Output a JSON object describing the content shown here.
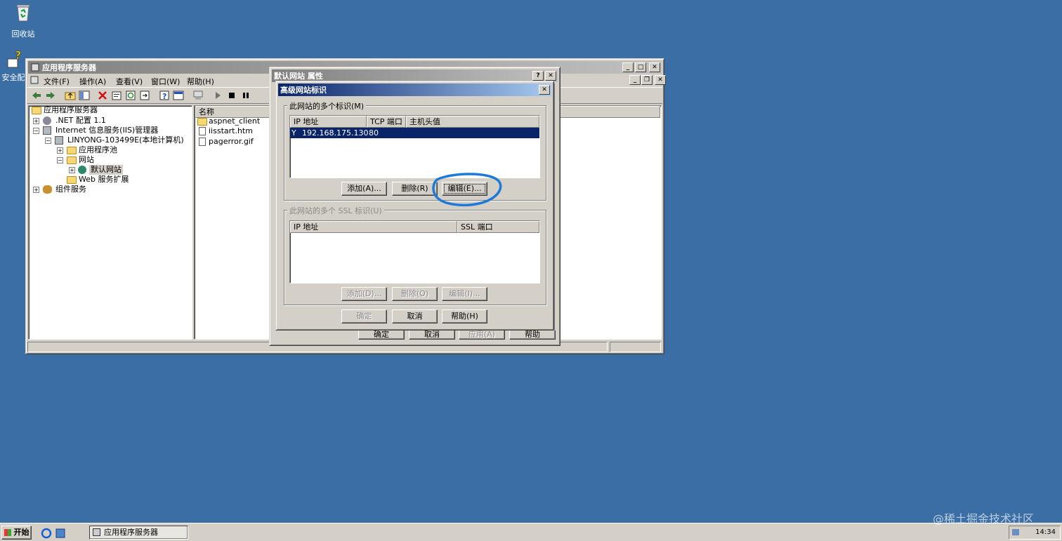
{
  "desktop": {
    "icons": [
      {
        "label": "回收站",
        "icon": "recycle-bin-icon"
      },
      {
        "label": "安全配",
        "icon": "security-config-icon"
      }
    ]
  },
  "main_window": {
    "title": "应用程序服务器",
    "menu": [
      "文件(F)",
      "操作(A)",
      "查看(V)",
      "窗口(W)",
      "帮助(H)"
    ],
    "tree": [
      {
        "label": "应用程序服务器"
      },
      {
        "label": ".NET 配置 1.1"
      },
      {
        "label": "Internet 信息服务(IIS)管理器"
      },
      {
        "label": "LINYONG-103499E(本地计算机)"
      },
      {
        "label": "应用程序池"
      },
      {
        "label": "网站"
      },
      {
        "label": "默认网站"
      },
      {
        "label": "Web 服务扩展"
      },
      {
        "label": "组件服务"
      }
    ],
    "list_header": "名称",
    "files": [
      "aspnet_client",
      "iisstart.htm",
      "pagerror.gif"
    ],
    "hidden_buttons": [
      "确定",
      "取消",
      "应用(A)",
      "帮助"
    ]
  },
  "properties_dialog": {
    "title": "默认网站 属性",
    "help_glyph": "?",
    "close_glyph": "✕"
  },
  "advanced_dialog": {
    "title": "高级网站标识",
    "close_glyph": "✕",
    "identities_group": {
      "label": "此网站的多个标识(M)",
      "columns": [
        "IP 地址",
        "TCP 端口",
        "主机头值"
      ],
      "rows": [
        {
          "ip": "192.168.175.130",
          "port": "80",
          "host": ""
        }
      ],
      "buttons": {
        "add": "添加(A)...",
        "remove": "删除(R)",
        "edit": "编辑(E)..."
      }
    },
    "ssl_group": {
      "label": "此网站的多个 SSL 标识(U)",
      "columns": [
        "IP 地址",
        "SSL 端口"
      ],
      "buttons": {
        "add": "添加(D)...",
        "remove": "删除(O)",
        "edit": "编辑(I)..."
      }
    },
    "footer": {
      "ok": "确定",
      "cancel": "取消",
      "help": "帮助(H)"
    }
  },
  "taskbar": {
    "start": "开始",
    "task": "应用程序服务器",
    "clock": "14:34"
  },
  "watermark": "@稀土掘金技术社区",
  "colors": {
    "desktop": "#3a6ea5",
    "active_title": "#0a246a",
    "selection": "#0a246a",
    "highlight_circle": "#1e7ad6"
  }
}
